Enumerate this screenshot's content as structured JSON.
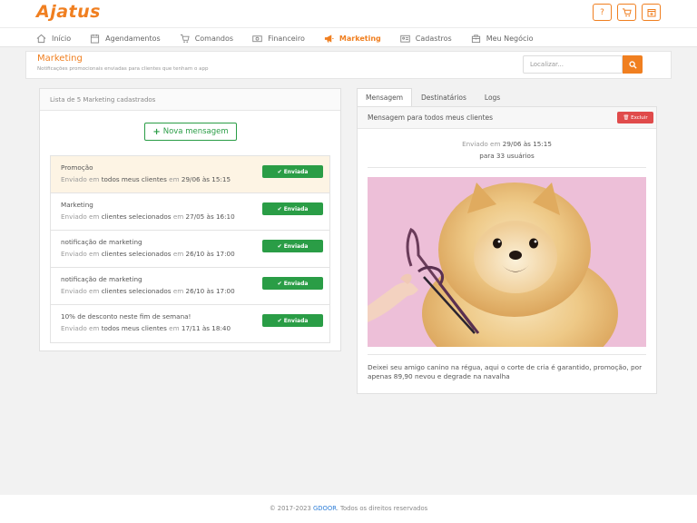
{
  "brand": {
    "logo": "Ajatus",
    "accent": "#f07f20",
    "success": "#2a9d46",
    "danger": "#e04b4b",
    "link": "#2f7fd8"
  },
  "top_icons": [
    {
      "name": "help-icon",
      "glyph": "?"
    },
    {
      "name": "cart-icon",
      "glyph": "🛒"
    },
    {
      "name": "calendar-add-icon",
      "glyph": "+"
    }
  ],
  "nav": {
    "items": [
      {
        "label": "Início",
        "icon": "home-icon"
      },
      {
        "label": "Agendamentos",
        "icon": "calendar-icon"
      },
      {
        "label": "Comandos",
        "icon": "cart-icon"
      },
      {
        "label": "Financeiro",
        "icon": "money-icon"
      },
      {
        "label": "Marketing",
        "icon": "megaphone-icon",
        "active": true
      },
      {
        "label": "Cadastros",
        "icon": "id-card-icon"
      },
      {
        "label": "Meu Negócio",
        "icon": "store-icon"
      }
    ]
  },
  "page": {
    "title": "Marketing",
    "subtitle": "Notificações promocionais enviadas para clientes que tenham o app",
    "search_placeholder": "Localizar..."
  },
  "list": {
    "header": "Lista de 5 Marketing cadastrados",
    "new_button": "Nova mensagem",
    "sent_prefix": "Enviado em",
    "in_word": "em",
    "status_label": "Enviada",
    "items": [
      {
        "title": "Promoção",
        "audience": "todos meus clientes",
        "date": "29/06 às 15:15",
        "selected": true
      },
      {
        "title": "Marketing",
        "audience": "clientes selecionados",
        "date": "27/05 às 16:10"
      },
      {
        "title": "notificação de marketing",
        "audience": "clientes selecionados",
        "date": "26/10 às 17:00"
      },
      {
        "title": "notificação de marketing",
        "audience": "clientes selecionados",
        "date": "26/10 às 17:00"
      },
      {
        "title": "10% de desconto neste fim de semana!",
        "audience": "todos meus clientes",
        "date": "17/11 às 18:40"
      }
    ]
  },
  "detail": {
    "tabs": [
      "Mensagem",
      "Destinatários",
      "Logs"
    ],
    "header": "Mensagem para todos meus clientes",
    "delete_label": "Excluir",
    "sent_prefix": "Enviado em",
    "sent_date": "29/06 às 15:15",
    "recipients": "para 33 usuários",
    "body": "Deixei seu amigo canino na régua, aqui o corte de cria é garantido, promoção, por apenas 89,90 nevou e degrade na navalha"
  },
  "footer": {
    "prefix": "© 2017-2023",
    "company": "GDOOR",
    "suffix": ". Todos os direitos reservados"
  }
}
